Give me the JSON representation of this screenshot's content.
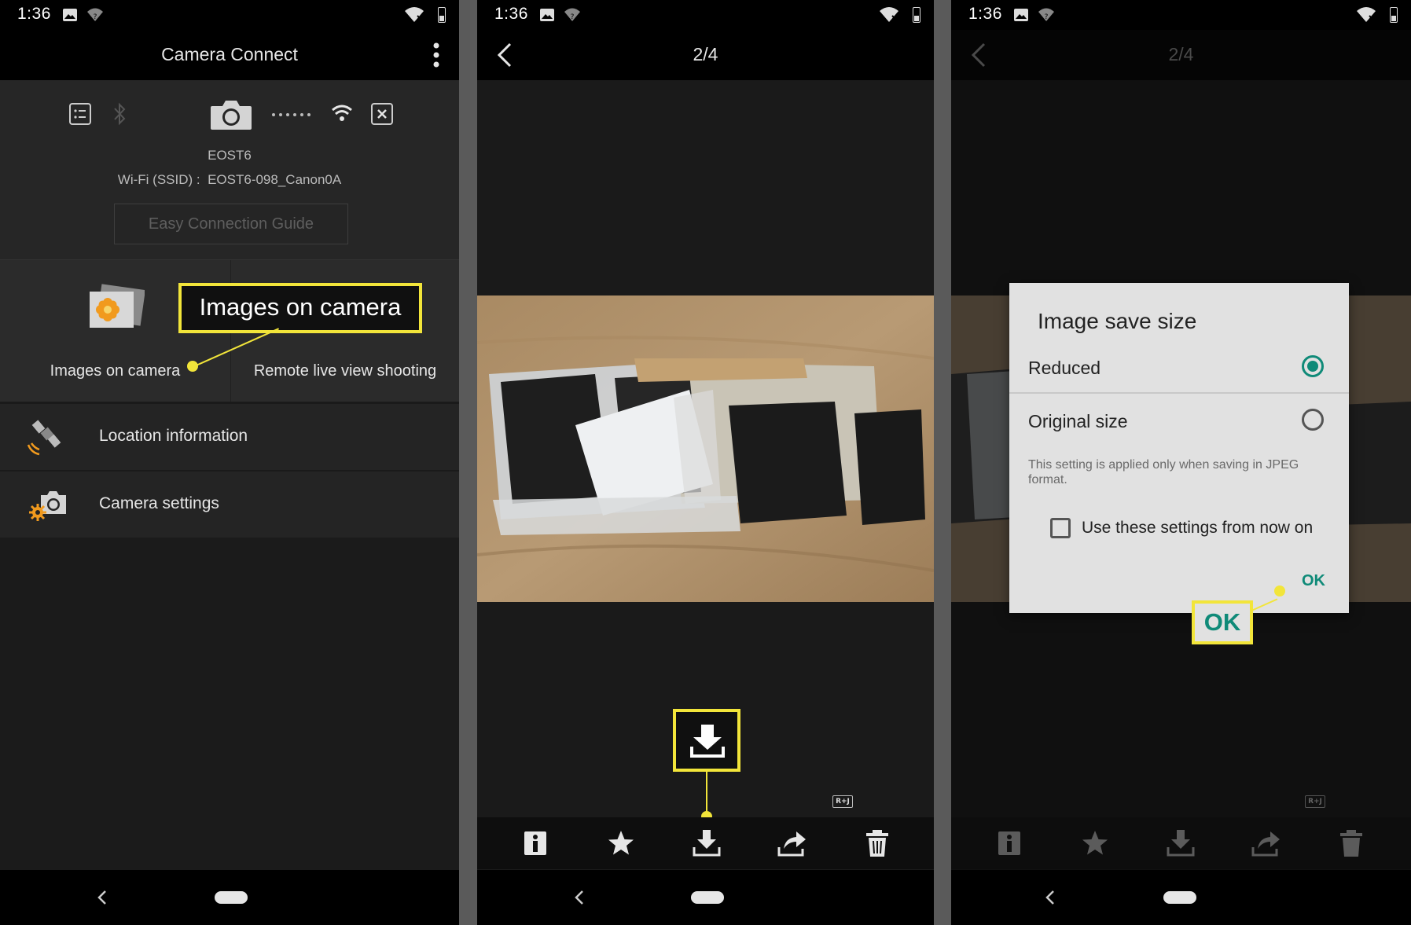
{
  "status": {
    "time": "1:36"
  },
  "screen1": {
    "title": "Camera Connect",
    "camera_name": "EOST6",
    "ssid_label": "Wi-Fi (SSID) :",
    "ssid_value": "EOST6-098_Canon0A",
    "guide_button": "Easy Connection Guide",
    "tiles": [
      {
        "label": "Images on camera"
      },
      {
        "label": "Remote live view shooting"
      }
    ],
    "rows": [
      {
        "label": "Location information"
      },
      {
        "label": "Camera settings"
      }
    ],
    "callout": "Images on camera"
  },
  "screen2": {
    "counter": "2/4",
    "rj_badge": "R+J"
  },
  "screen3": {
    "counter": "2/4",
    "rj_badge": "R+J",
    "dialog": {
      "title": "Image save size",
      "options": [
        {
          "label": "Reduced",
          "selected": true
        },
        {
          "label": "Original size",
          "selected": false
        }
      ],
      "note": "This setting is applied only when saving in JPEG format.",
      "checkbox_label": "Use these settings from now on",
      "checkbox_checked": false,
      "ok_label": "OK"
    },
    "callout": "OK"
  },
  "colors": {
    "highlight": "#f2e53a",
    "accent": "#0f8a78"
  }
}
